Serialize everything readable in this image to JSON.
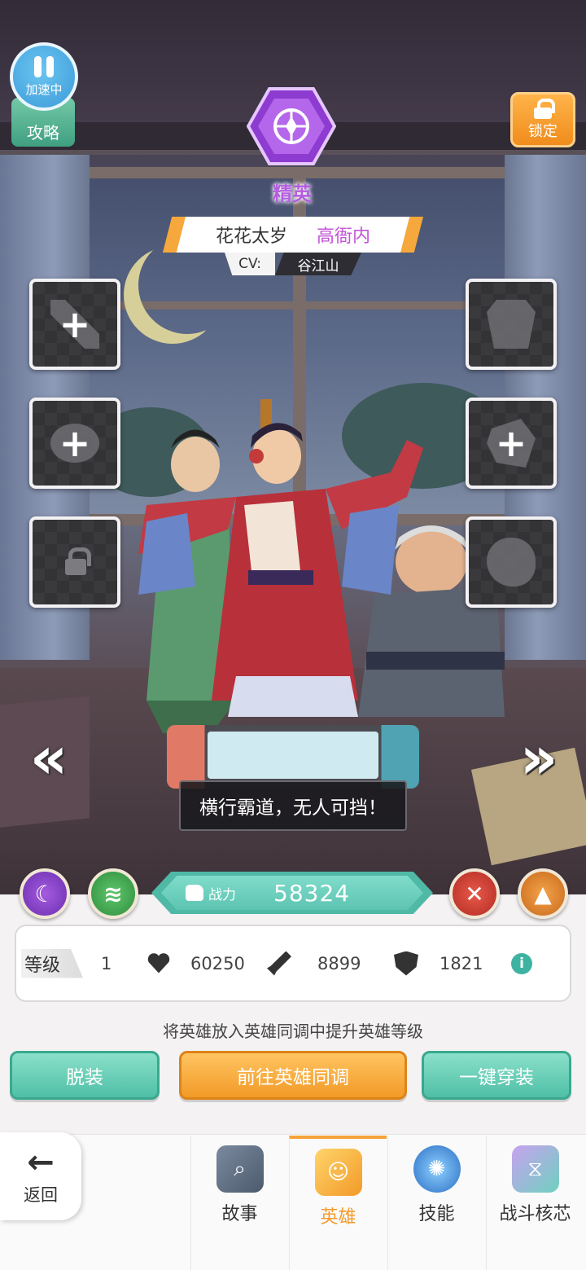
{
  "top": {
    "speed_label": "加速中",
    "guide_label": "攻略",
    "lock_label": "锁定"
  },
  "hero": {
    "rank": "精英",
    "name": "花花太岁",
    "title": "高衙内",
    "cv_label": "CV:",
    "cv_value": "谷江山",
    "quote": "横行霸道，无人可挡！"
  },
  "slots": {
    "left": [
      {
        "icon": "weapon-silhouette",
        "state": "add"
      },
      {
        "icon": "helmet-silhouette",
        "state": "add"
      },
      {
        "icon": "padlock",
        "state": "locked"
      }
    ],
    "right": [
      {
        "icon": "armor-silhouette",
        "state": "empty"
      },
      {
        "icon": "accessory-silhouette",
        "state": "add"
      },
      {
        "icon": "amulet-silhouette",
        "state": "empty"
      }
    ],
    "plus_symbol": "+"
  },
  "nav_arrows": {
    "prev": "«",
    "next": "»"
  },
  "power": {
    "label": "战力",
    "value": "58324"
  },
  "stats": {
    "level_label": "等级",
    "level": "1",
    "hp": "60250",
    "attack": "8899",
    "defense": "1821",
    "info_symbol": "i"
  },
  "hint": "将英雄放入英雄同调中提升英雄等级",
  "buttons": {
    "unequip": "脱装",
    "goto_sync": "前往英雄同调",
    "quick_equip": "一键穿装"
  },
  "bottom_nav": {
    "back_symbol": "←",
    "back_label": "返回",
    "tabs": [
      {
        "label": "故事",
        "icon": "story-icon",
        "active": false
      },
      {
        "label": "英雄",
        "icon": "hero-icon",
        "active": true
      },
      {
        "label": "技能",
        "icon": "skill-icon",
        "active": false
      },
      {
        "label": "战斗核芯",
        "icon": "core-icon",
        "active": false
      }
    ]
  },
  "colors": {
    "accent_teal": "#4fbfa6",
    "accent_orange": "#f29a27",
    "rank_purple": "#b45de0",
    "active_tab": "#f49b2c"
  }
}
